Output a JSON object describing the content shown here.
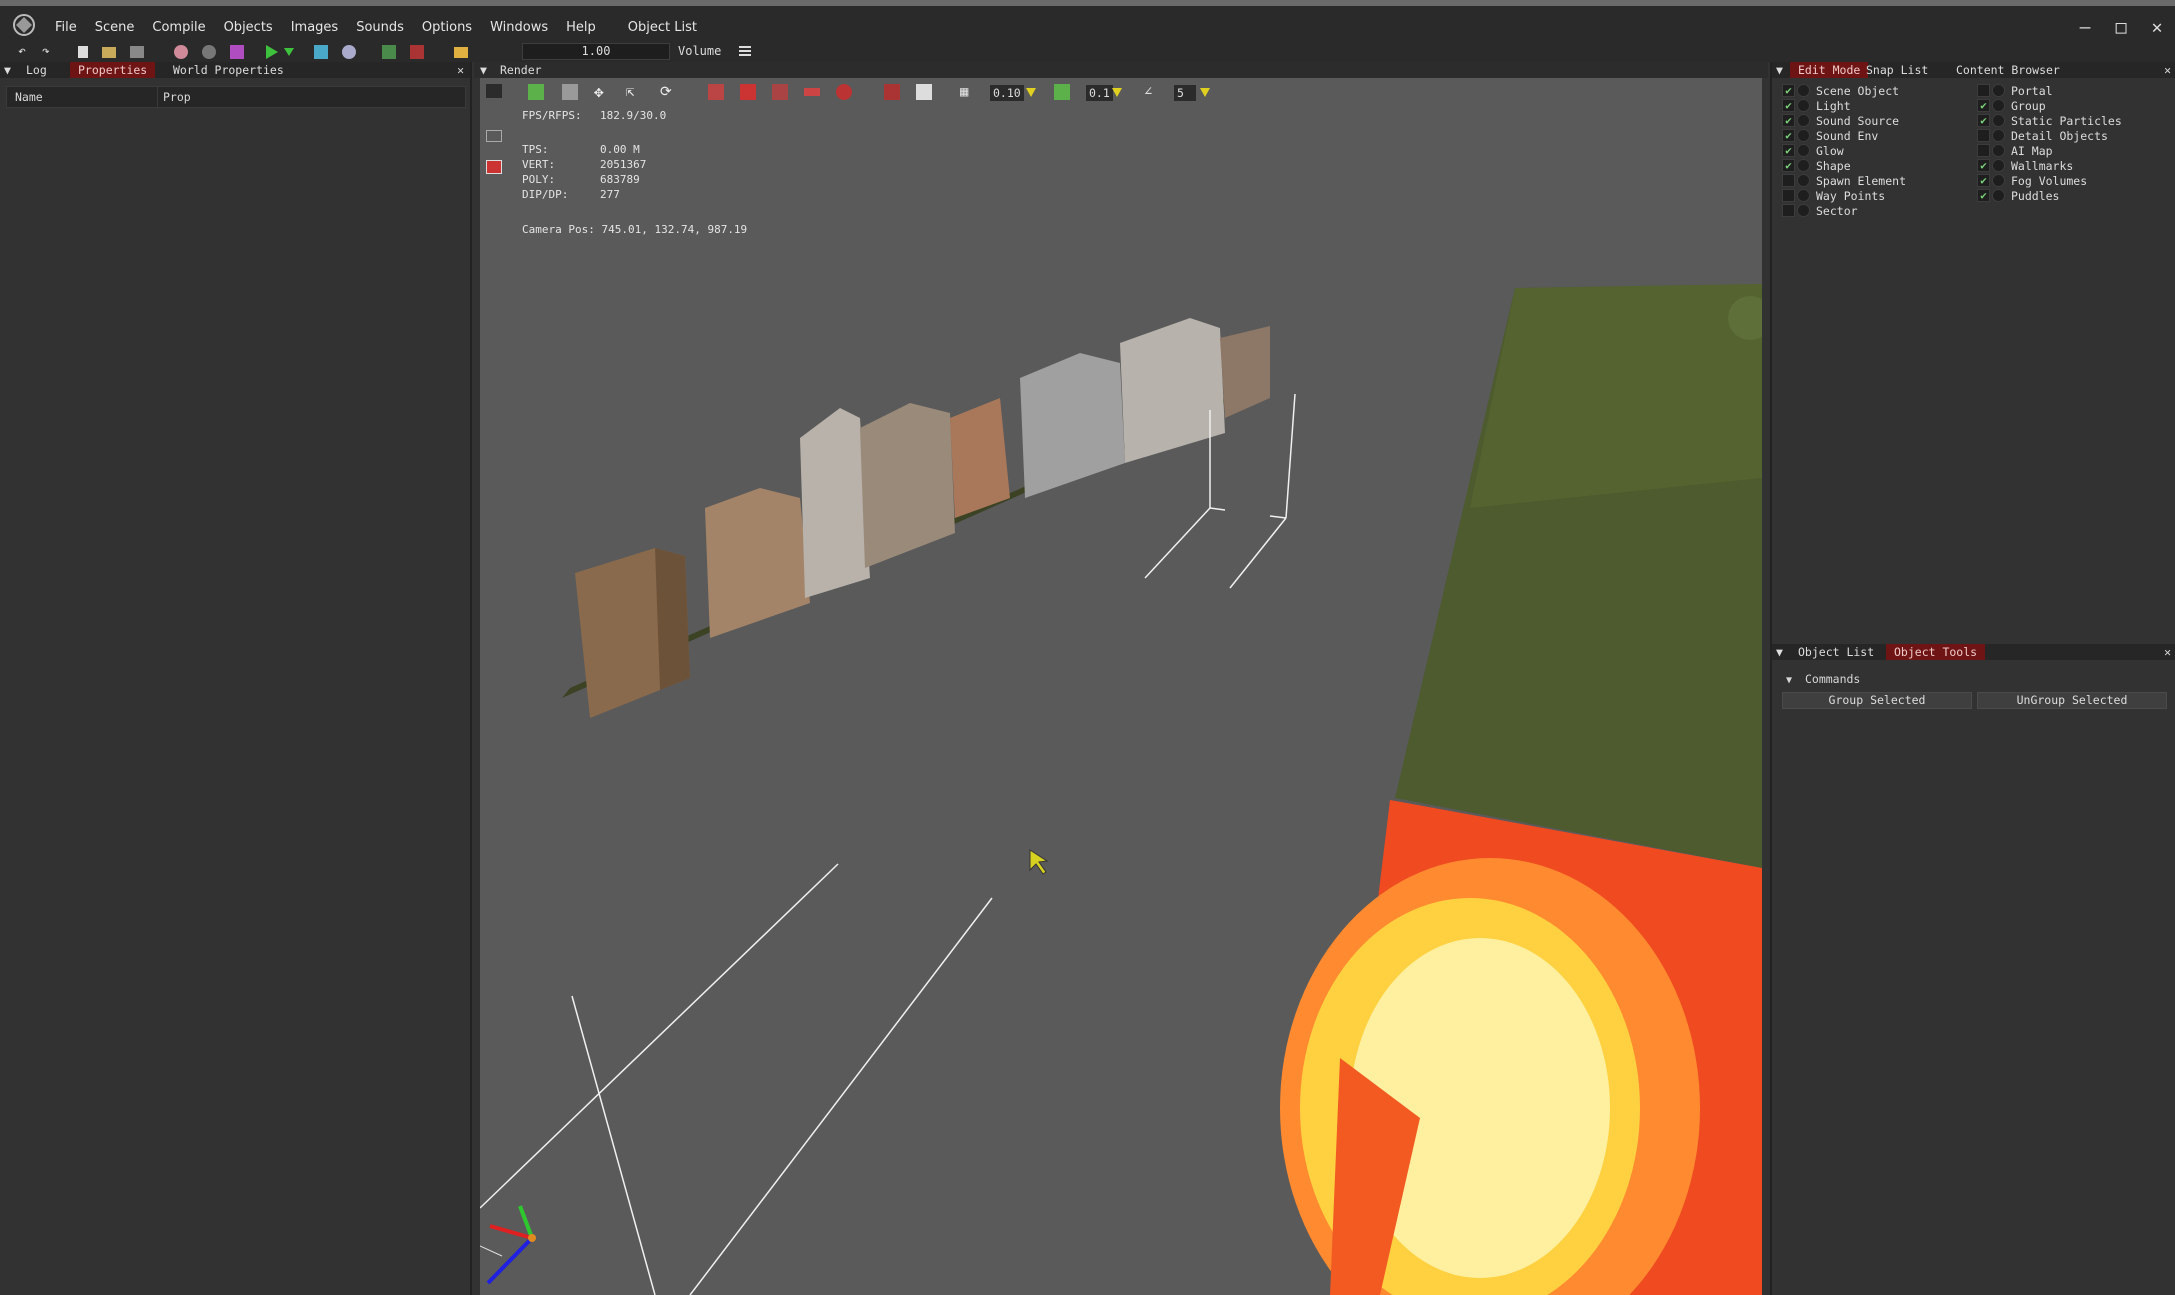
{
  "menu": [
    "File",
    "Scene",
    "Compile",
    "Objects",
    "Images",
    "Sounds",
    "Options",
    "Windows",
    "Help",
    "Object List"
  ],
  "toolbar": {
    "volume_value": "1.00",
    "volume_label": "Volume"
  },
  "left_panel": {
    "tabs": [
      "Log",
      "Properties",
      "World Properties"
    ],
    "active_tab": "Properties",
    "table_headers": [
      "Name",
      "Prop"
    ]
  },
  "render": {
    "title": "Render",
    "grid_value": "0.10",
    "snap_value": "0.1",
    "angle_value": "5",
    "stats": {
      "fps_label": "FPS/RFPS:",
      "fps_value": "182.9/30.0",
      "tps_label": "TPS:",
      "tps_value": "0.00 M",
      "vert_label": "VERT:",
      "vert_value": "2051367",
      "poly_label": "POLY:",
      "poly_value": "683789",
      "dip_label": "DIP/DP:",
      "dip_value": "277",
      "camera_label": "Camera Pos:",
      "camera_value": "745.01, 132.74, 987.19"
    }
  },
  "right_panel": {
    "tabs": [
      "Edit Mode",
      "Snap List",
      "Content Browser"
    ],
    "active_tab": "Edit Mode",
    "col1": [
      {
        "label": "Scene Object",
        "checked": true
      },
      {
        "label": "Light",
        "checked": true
      },
      {
        "label": "Sound Source",
        "checked": true
      },
      {
        "label": "Sound Env",
        "checked": true
      },
      {
        "label": "Glow",
        "checked": true
      },
      {
        "label": "Shape",
        "checked": true
      },
      {
        "label": "Spawn Element",
        "checked": false
      },
      {
        "label": "Way Points",
        "checked": false
      },
      {
        "label": "Sector",
        "checked": false
      }
    ],
    "col2": [
      {
        "label": "Portal",
        "checked": false
      },
      {
        "label": "Group",
        "checked": true
      },
      {
        "label": "Static Particles",
        "checked": true
      },
      {
        "label": "Detail Objects",
        "checked": false
      },
      {
        "label": "AI Map",
        "checked": false
      },
      {
        "label": "Wallmarks",
        "checked": true
      },
      {
        "label": "Fog Volumes",
        "checked": true
      },
      {
        "label": "Puddles",
        "checked": true
      }
    ],
    "lower_tabs": [
      "Object List",
      "Object Tools"
    ],
    "lower_active": "Object Tools",
    "commands_label": "Commands",
    "group_btn": "Group Selected",
    "ungroup_btn": "UnGroup Selected"
  },
  "colors": {
    "accent_tab": "#6f1414",
    "viewport_bg": "#5a5a5a",
    "terrain": "#4b5a2c"
  }
}
